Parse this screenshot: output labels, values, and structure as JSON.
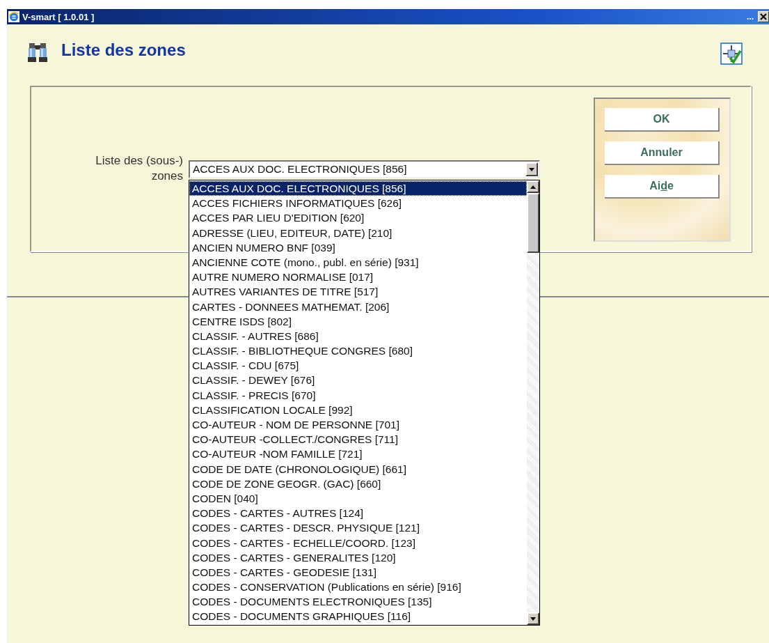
{
  "window": {
    "title": "V-smart [ 1.0.01 ]",
    "title_bar_more": "..."
  },
  "page": {
    "title": "Liste des zones"
  },
  "form": {
    "label": "Liste des (sous-) zones",
    "select": {
      "value": "ACCES AUX DOC. ELECTRONIQUES [856]",
      "expanded": true,
      "options": [
        {
          "label": "ACCES AUX DOC. ELECTRONIQUES [856]",
          "selected": true
        },
        {
          "label": "ACCES FICHIERS INFORMATIQUES [626]",
          "selected": false
        },
        {
          "label": "ACCES PAR LIEU D'EDITION [620]",
          "selected": false
        },
        {
          "label": "ADRESSE (LIEU, EDITEUR, DATE) [210]",
          "selected": false
        },
        {
          "label": "ANCIEN NUMERO BNF [039]",
          "selected": false
        },
        {
          "label": "ANCIENNE COTE (mono., publ. en série) [931]",
          "selected": false
        },
        {
          "label": "AUTRE NUMERO NORMALISE [017]",
          "selected": false
        },
        {
          "label": "AUTRES VARIANTES DE TITRE [517]",
          "selected": false
        },
        {
          "label": "CARTES - DONNEES MATHEMAT. [206]",
          "selected": false
        },
        {
          "label": "CENTRE ISDS [802]",
          "selected": false
        },
        {
          "label": "CLASSIF. - AUTRES [686]",
          "selected": false
        },
        {
          "label": "CLASSIF. - BIBLIOTHEQUE CONGRES [680]",
          "selected": false
        },
        {
          "label": "CLASSIF. - CDU [675]",
          "selected": false
        },
        {
          "label": "CLASSIF. - DEWEY [676]",
          "selected": false
        },
        {
          "label": "CLASSIF. - PRECIS [670]",
          "selected": false
        },
        {
          "label": "CLASSIFICATION LOCALE [992]",
          "selected": false
        },
        {
          "label": "CO-AUTEUR - NOM DE PERSONNE [701]",
          "selected": false
        },
        {
          "label": "CO-AUTEUR -COLLECT./CONGRES [711]",
          "selected": false
        },
        {
          "label": "CO-AUTEUR -NOM FAMILLE [721]",
          "selected": false
        },
        {
          "label": "CODE DE DATE (CHRONOLOGIQUE) [661]",
          "selected": false
        },
        {
          "label": "CODE DE ZONE GEOGR. (GAC) [660]",
          "selected": false
        },
        {
          "label": "CODEN [040]",
          "selected": false
        },
        {
          "label": "CODES - CARTES - AUTRES [124]",
          "selected": false
        },
        {
          "label": "CODES - CARTES - DESCR. PHYSIQUE [121]",
          "selected": false
        },
        {
          "label": "CODES - CARTES - ECHELLE/COORD. [123]",
          "selected": false
        },
        {
          "label": "CODES - CARTES - GENERALITES [120]",
          "selected": false
        },
        {
          "label": "CODES - CARTES - GEODESIE [131]",
          "selected": false
        },
        {
          "label": "CODES - CONSERVATION (Publications en série) [916]",
          "selected": false
        },
        {
          "label": "CODES - DOCUMENTS ELECTRONIQUES [135]",
          "selected": false
        },
        {
          "label": "CODES - DOCUMENTS GRAPHIQUES [116]",
          "selected": false
        }
      ]
    }
  },
  "buttons": [
    {
      "label": "OK"
    },
    {
      "label": "Annuler"
    },
    {
      "label": "Ai",
      "access_key": "d",
      "label_after": "e"
    }
  ]
}
